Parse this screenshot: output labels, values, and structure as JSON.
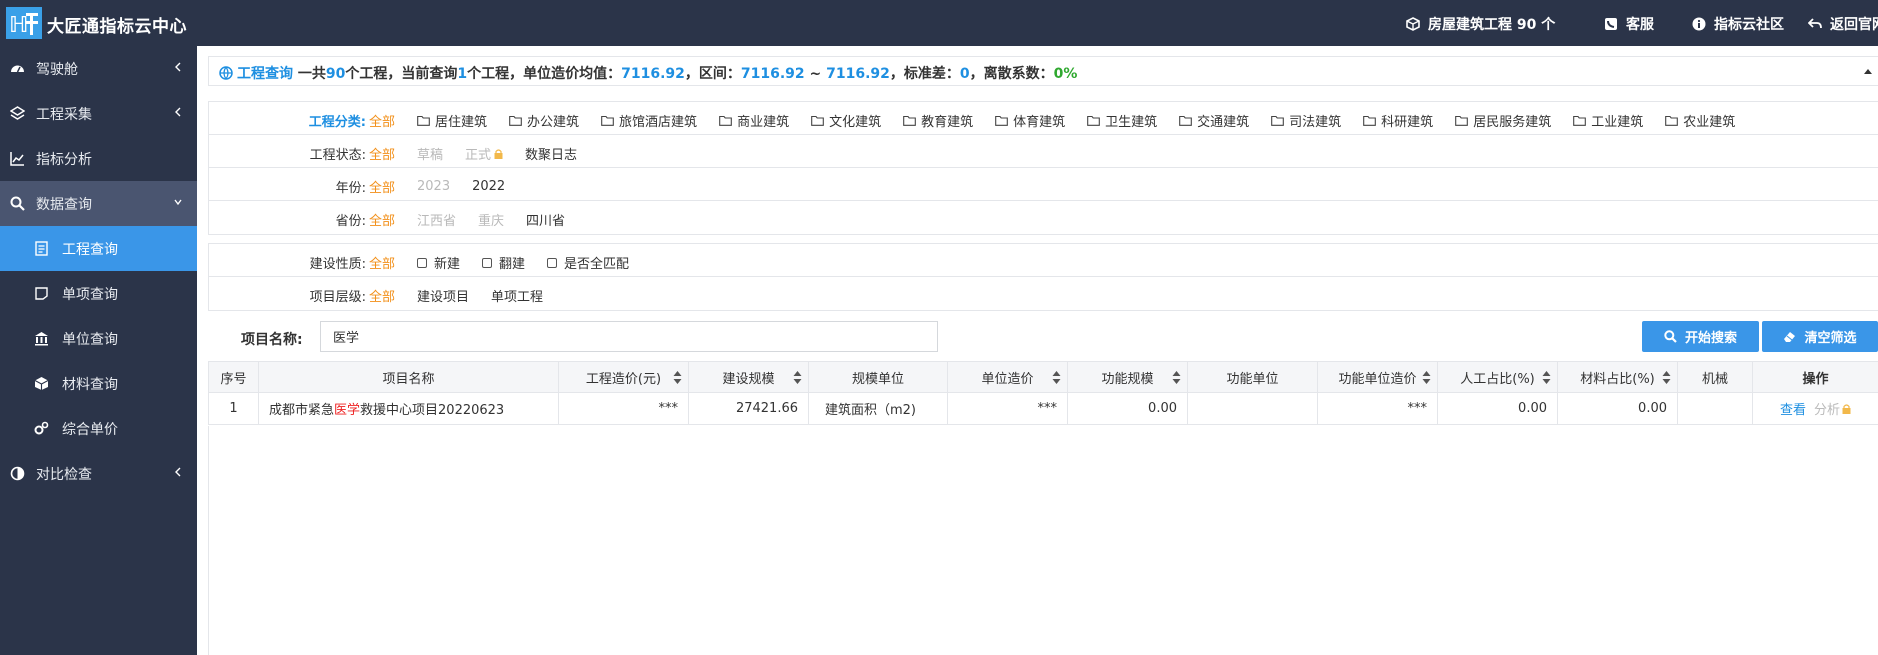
{
  "header": {
    "brand": "大匠通指标云中心",
    "nav": [
      {
        "label": "房屋建筑工程 90 个",
        "icon": "cube-icon"
      },
      {
        "label": "客服",
        "icon": "phone-icon"
      },
      {
        "label": "指标云社区",
        "icon": "info-icon"
      },
      {
        "label": "返回官网",
        "icon": "back-arrow-icon"
      }
    ]
  },
  "sidebar": {
    "items": [
      {
        "label": "驾驶舱",
        "icon": "dashboard-icon"
      },
      {
        "label": "工程采集",
        "icon": "layers-icon"
      },
      {
        "label": "指标分析",
        "icon": "line-chart-icon"
      },
      {
        "label": "数据查询",
        "icon": "search-icon"
      },
      {
        "label": "工程查询",
        "icon": "document-icon"
      },
      {
        "label": "单项查询",
        "icon": "square-icon"
      },
      {
        "label": "单位查询",
        "icon": "bank-icon"
      },
      {
        "label": "材料查询",
        "icon": "box-icon"
      },
      {
        "label": "综合单价",
        "icon": "gears-icon"
      },
      {
        "label": "对比检查",
        "icon": "contrast-icon"
      }
    ]
  },
  "summary": {
    "title": "工程查询",
    "p1": "一共",
    "total": "90",
    "p2": "个工程，当前查询",
    "current": "1",
    "p3": "个工程，单位造价均值：",
    "avg": "7116.92",
    "p4": "，区间：",
    "range_min": "7116.92",
    "range_sep": " ~ ",
    "range_max": "7116.92",
    "p5": "，标准差：",
    "std": "0",
    "p6": "，离散系数：",
    "cv": "0%"
  },
  "filters": {
    "category": {
      "label": "工程分类:",
      "all": "全部",
      "options": [
        "居住建筑",
        "办公建筑",
        "旅馆酒店建筑",
        "商业建筑",
        "文化建筑",
        "教育建筑",
        "体育建筑",
        "卫生建筑",
        "交通建筑",
        "司法建筑",
        "科研建筑",
        "居民服务建筑",
        "工业建筑",
        "农业建筑"
      ]
    },
    "status": {
      "label": "工程状态:",
      "all": "全部",
      "draft": "草稿",
      "formal": "正式",
      "log": "数聚日志"
    },
    "year": {
      "label": "年份:",
      "all": "全部",
      "options": [
        "2023",
        "2022"
      ]
    },
    "province": {
      "label": "省份:",
      "all": "全部",
      "options": [
        "江西省",
        "重庆",
        "四川省"
      ]
    },
    "nature": {
      "label": "建设性质:",
      "all": "全部",
      "options": [
        "新建",
        "翻建",
        "是否全匹配"
      ]
    },
    "level": {
      "label": "项目层级:",
      "all": "全部",
      "options": [
        "建设项目",
        "单项工程"
      ]
    }
  },
  "search": {
    "label": "项目名称:",
    "value": "医学",
    "start_btn": "开始搜索",
    "clear_btn": "清空筛选"
  },
  "table": {
    "headers": [
      "序号",
      "项目名称",
      "工程造价(元)",
      "建设规模",
      "规模单位",
      "单位造价",
      "功能规模",
      "功能单位",
      "功能单位造价",
      "人工占比(%)",
      "材料占比(%)",
      "机械",
      "操作"
    ],
    "rows": [
      {
        "index": "1",
        "name_pre": "成都市紧急",
        "name_hl": "医学",
        "name_post": "救援中心项目20220623",
        "cost": "***",
        "scale": "27421.66",
        "unit": "建筑面积（m2)",
        "unit_price": "***",
        "func_scale": "0.00",
        "func_unit": "",
        "func_unit_price": "***",
        "labor": "0.00",
        "material": "0.00",
        "machine": "",
        "view": "查看",
        "analyze": "分析"
      }
    ]
  },
  "colors": {
    "accent": "#3a96e8",
    "nav_bg": "#2b3449",
    "selected": "#f2901a",
    "highlight": "#e22222"
  }
}
